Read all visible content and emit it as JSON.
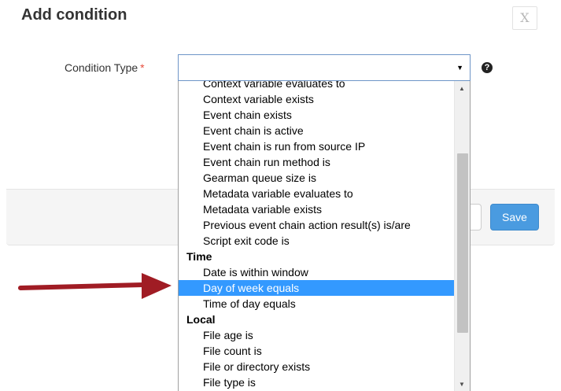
{
  "dialog": {
    "title": "Add condition",
    "close_label": "X"
  },
  "form": {
    "condition_type_label": "Condition Type",
    "required_marker": "*",
    "select_value": "",
    "select_arrow": "▼",
    "help_icon": "?"
  },
  "footer": {
    "save_label": "Save"
  },
  "dropdown": {
    "scroll_up": "▲",
    "scroll_down": "▼",
    "entries": [
      {
        "type": "option",
        "label": "Context variable evaluates to"
      },
      {
        "type": "option",
        "label": "Context variable exists"
      },
      {
        "type": "option",
        "label": "Event chain exists"
      },
      {
        "type": "option",
        "label": "Event chain is active"
      },
      {
        "type": "option",
        "label": "Event chain is run from source IP"
      },
      {
        "type": "option",
        "label": "Event chain run method is"
      },
      {
        "type": "option",
        "label": "Gearman queue size is"
      },
      {
        "type": "option",
        "label": "Metadata variable evaluates to"
      },
      {
        "type": "option",
        "label": "Metadata variable exists"
      },
      {
        "type": "option",
        "label": "Previous event chain action result(s) is/are"
      },
      {
        "type": "option",
        "label": "Script exit code is"
      },
      {
        "type": "group",
        "label": "Time"
      },
      {
        "type": "option",
        "label": "Date is within window"
      },
      {
        "type": "option",
        "label": "Day of week equals",
        "selected": true
      },
      {
        "type": "option",
        "label": "Time of day equals"
      },
      {
        "type": "group",
        "label": "Local"
      },
      {
        "type": "option",
        "label": "File age is"
      },
      {
        "type": "option",
        "label": "File count is"
      },
      {
        "type": "option",
        "label": "File or directory exists"
      },
      {
        "type": "option",
        "label": "File type is"
      }
    ]
  },
  "colors": {
    "highlight": "#3399ff",
    "save_button": "#4a9be0",
    "pointer_arrow": "#a01c24"
  },
  "icons": {
    "pointer": "red-arrow-icon",
    "help": "question-circle-icon",
    "close": "close-icon"
  }
}
